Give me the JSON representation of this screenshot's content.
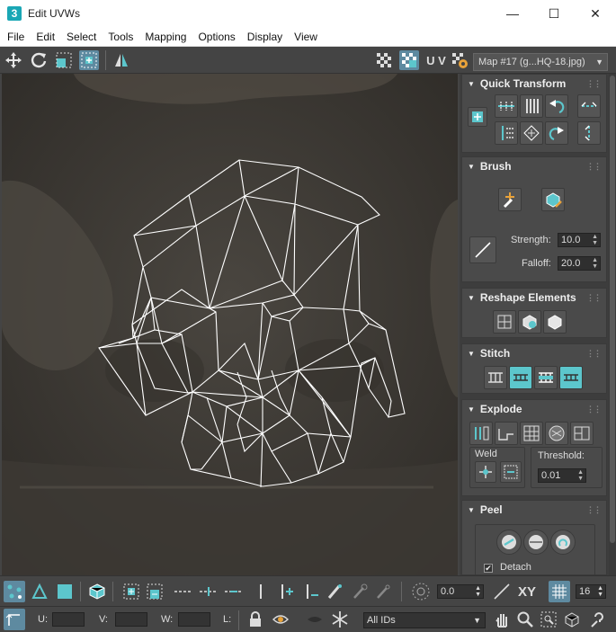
{
  "window": {
    "title": "Edit UVWs",
    "app_icon": "3",
    "minimize": "—",
    "maximize": "☐",
    "close": "✕"
  },
  "menu": [
    "File",
    "Edit",
    "Select",
    "Tools",
    "Mapping",
    "Options",
    "Display",
    "View"
  ],
  "toolbar": {
    "uv_label": "U V",
    "map_select": "Map #17 (g...HQ-18.jpg)"
  },
  "panel": {
    "quick_transform": {
      "title": "Quick Transform"
    },
    "brush": {
      "title": "Brush",
      "strength_label": "Strength:",
      "strength_value": "10.0",
      "falloff_label": "Falloff:",
      "falloff_value": "20.0"
    },
    "reshape": {
      "title": "Reshape Elements"
    },
    "stitch": {
      "title": "Stitch"
    },
    "explode": {
      "title": "Explode",
      "weld_label": "Weld",
      "threshold_label": "Threshold:",
      "threshold_value": "0.01"
    },
    "peel": {
      "title": "Peel",
      "detach_label": "Detach",
      "detach_checked": "✔"
    }
  },
  "bottom": {
    "angle_value": "0.0",
    "xy_label": "XY",
    "grid_value": "16",
    "u_label": "U:",
    "v_label": "V:",
    "w_label": "W:",
    "l_label": "L:",
    "ids_select": "All IDs"
  },
  "colors": {
    "accent": "#4fc3c9",
    "active_bg": "#5e8aa0",
    "panel_bg": "#4a4a4a"
  }
}
